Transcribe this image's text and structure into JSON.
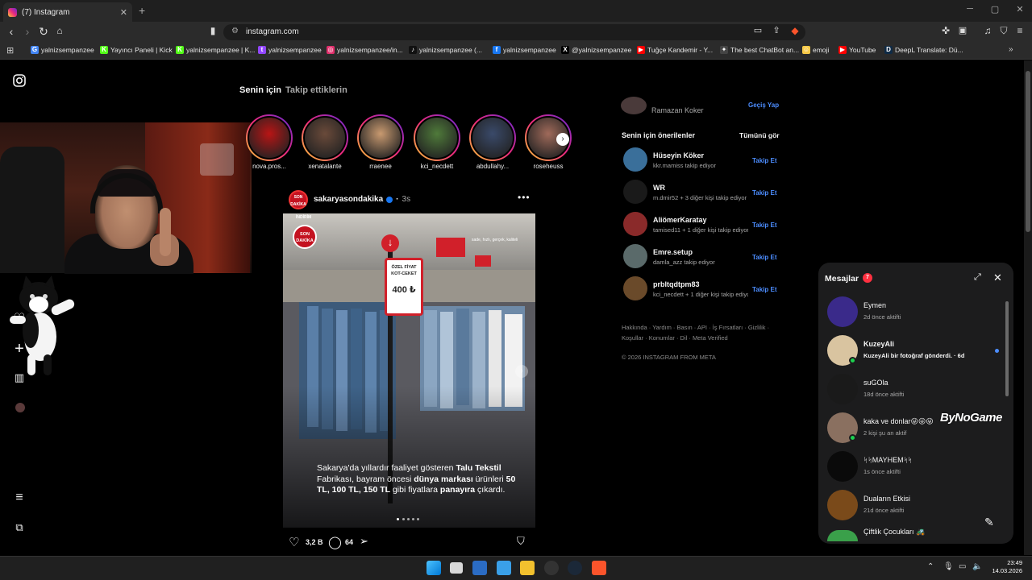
{
  "browser": {
    "tab_title": "(7) Instagram",
    "url": "instagram.com",
    "bookmarks": [
      {
        "label": "yalnizsempanzee",
        "color": "#4285f4",
        "icon": "G"
      },
      {
        "label": "Yayıncı Paneli | Kick",
        "color": "#53fc18",
        "icon": "K"
      },
      {
        "label": "yalnizsempanzee | K...",
        "color": "#53fc18",
        "icon": "K"
      },
      {
        "label": "yalnizsempanzee",
        "color": "#9146ff",
        "icon": "t"
      },
      {
        "label": "yalnizsempanzee/in...",
        "color": "#e1306c",
        "icon": "◎"
      },
      {
        "label": "yalnizsempanzee (...",
        "color": "#111111",
        "icon": "♪"
      },
      {
        "label": "yalnizsempanzee",
        "color": "#1877f2",
        "icon": "f"
      },
      {
        "label": "@yalnizsempanzee",
        "color": "#000000",
        "icon": "X"
      },
      {
        "label": "Tuğçe Kandemir - Y...",
        "color": "#ff0000",
        "icon": "▶"
      },
      {
        "label": "The best ChatBot an...",
        "color": "#444444",
        "icon": "✦"
      },
      {
        "label": "emoji",
        "color": "#f7c948",
        "icon": "☺"
      },
      {
        "label": "YouTube",
        "color": "#ff0000",
        "icon": "▶"
      },
      {
        "label": "DeepL Translate: Dü...",
        "color": "#0f2b46",
        "icon": "D"
      }
    ]
  },
  "feed_tabs": {
    "for_you": "Senin için",
    "following": "Takip ettiklerin"
  },
  "stories": [
    {
      "name": "nova.pros..."
    },
    {
      "name": "xenatalante"
    },
    {
      "name": "rraenee"
    },
    {
      "name": "kci_necdett"
    },
    {
      "name": "abdullahy..."
    },
    {
      "name": "roseheuss"
    }
  ],
  "post": {
    "username": "sakaryasondakika",
    "time": "3s",
    "likes": "3,2 B",
    "comments": "64",
    "sign_top": "ÖZEL FİYAT",
    "sign_mid": "KOT-CEKET",
    "sign_price": "400 ₺",
    "corner_label": "İNDİRİM",
    "watermark": "sade, hızlı, gerçek, kaliteli",
    "caption": {
      "p1": "Sakarya'da yıllardır faaliyet gösteren ",
      "b1": "Talu Tekstil",
      "p2": " Fabrikası, bayram öncesi ",
      "b2": "dünya markası",
      "p3": " ürünleri ",
      "b3": "50 TL, 100 TL, 150 TL",
      "p4": " gibi fiyatlara ",
      "b4": "panayıra",
      "p5": " çıkardı."
    }
  },
  "sidebar_right": {
    "top_user_sub": "Ramazan Koker",
    "switch": "Geçiş Yap",
    "suggestions_title": "Senin için önerilenler",
    "see_all": "Tümünü gör",
    "follow_label": "Takip Et",
    "suggestions": [
      {
        "name": "Hüseyin Köker",
        "sub": "kkr.mamiss takip ediyor"
      },
      {
        "name": "WR",
        "sub": "m.dmir52 + 3 diğer kişi takip ediyor"
      },
      {
        "name": "AliömerKaratay",
        "sub": "tamised11 + 1 diğer kişi takip ediyor"
      },
      {
        "name": "Emre.setup",
        "sub": "damla_azz takip ediyor"
      },
      {
        "name": "prbltqdtpm83",
        "sub": "kci_necdett + 1 diğer kişi takip ediyor"
      }
    ],
    "footer": "Hakkında · Yardım · Basın · API · İş Fırsatları · Gizlilik · Koşullar · Konumlar · Dil · Meta Verified",
    "copyright": "© 2026 INSTAGRAM FROM META"
  },
  "messages": {
    "title": "Mesajlar",
    "badge": "7",
    "overlay_brand": "ByNoGame",
    "items": [
      {
        "name": "Eymen",
        "sub": "2d önce aktifti",
        "online": false,
        "unread": false
      },
      {
        "name": "KuzeyAli",
        "sub": "KuzeyAli bir fotoğraf gönderdi. · 6d",
        "online": true,
        "unread": true
      },
      {
        "name": "suGOla",
        "sub": "18d önce aktifti",
        "online": false,
        "unread": false
      },
      {
        "name": "kaka ve donlar😜😜😜",
        "sub": "2 kişi şu an aktif",
        "online": true,
        "unread": false
      },
      {
        "name": "ᛋᛋMAYHEMᛋᛋ",
        "sub": "1s önce aktifti",
        "online": false,
        "unread": false
      },
      {
        "name": "Duaların Etkisi",
        "sub": "21d önce aktifti",
        "online": false,
        "unread": false
      },
      {
        "name": "Çiftlik Çocukları 🚜",
        "sub": "",
        "online": false,
        "unread": false
      }
    ]
  },
  "taskbar": {
    "time": "23:49",
    "date": "14.03.2026"
  }
}
